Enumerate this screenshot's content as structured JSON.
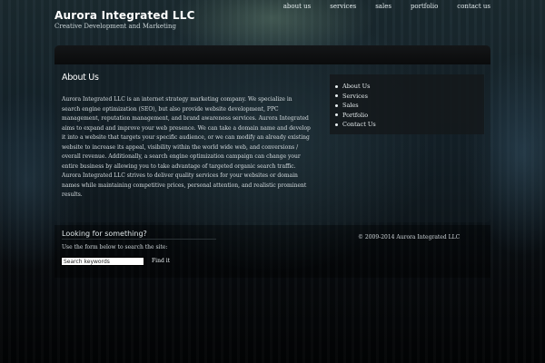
{
  "header": {
    "site_title": "Aurora Integrated LLC",
    "tagline": "Creative Development and Marketing"
  },
  "top_nav": {
    "items": [
      "about us",
      "services",
      "sales",
      "portfolio",
      "contact us"
    ]
  },
  "content": {
    "page_title": "About Us",
    "body": "Aurora Integrated LLC is an internet strategy marketing company.  We specialize in search engine optimization (SEO), but also provide website development, PPC management, reputation management, and brand awareness services.  Aurora Integrated aims to expand and improve your web presence.  We can take a domain name and develop it into a website that targets your specific audience, or we can modify an already existing website to increase its appeal, visibility within the world wide web, and conversions / overall revenue.  Additionally, a search engine optimization campaign can change your entire business by allowing you to take advantage of targeted organic search traffic. Aurora Integrated LLC strives to deliver quality services for your websites or domain names while maintaining competitive prices, personal attention, and realistic prominent results."
  },
  "sidebar": {
    "items": [
      "About Us",
      "Services",
      "Sales",
      "Portfolio",
      "Contact Us"
    ]
  },
  "search": {
    "heading": "Looking for something?",
    "description": "Use the form below to search the site:",
    "placeholder": "Search keywords",
    "button_label": "Find it"
  },
  "footer": {
    "copyright": "© 2009-2014 Aurora Integrated LLC"
  }
}
